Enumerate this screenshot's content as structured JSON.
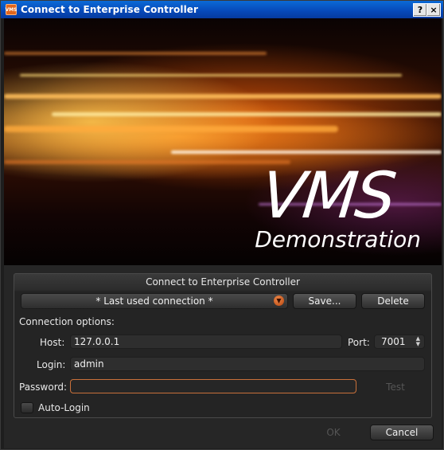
{
  "window": {
    "title": "Connect to Enterprise Controller",
    "app_icon_text": "VMS",
    "help_button": "?",
    "close_button": "×"
  },
  "banner": {
    "logo": "VMS",
    "subtitle": "Demonstration"
  },
  "form": {
    "group_title": "Connect to Enterprise Controller",
    "connection_selected": "* Last used connection *",
    "save_label": "Save...",
    "delete_label": "Delete",
    "options_heading": "Connection options:",
    "host_label": "Host:",
    "host_value": "127.0.0.1",
    "port_label": "Port:",
    "port_value": "7001",
    "login_label": "Login:",
    "login_value": "admin",
    "password_label": "Password:",
    "password_value": "",
    "test_label": "Test",
    "auto_login_label": "Auto-Login",
    "auto_login_checked": false
  },
  "footer": {
    "ok_label": "OK",
    "cancel_label": "Cancel"
  }
}
